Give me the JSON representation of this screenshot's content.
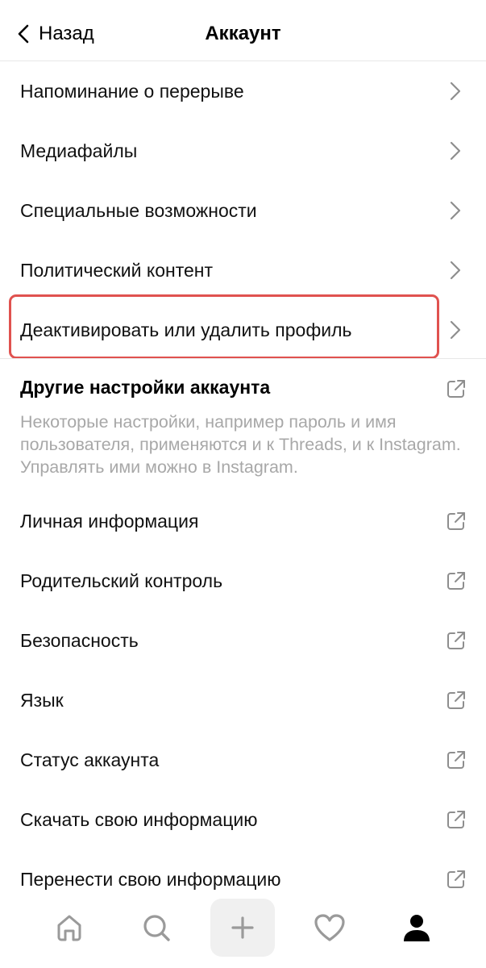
{
  "header": {
    "back_label": "Назад",
    "title": "Аккаунт"
  },
  "items": [
    {
      "label": "Напоминание о перерыве"
    },
    {
      "label": "Медиафайлы"
    },
    {
      "label": "Специальные возможности"
    },
    {
      "label": "Политический контент"
    },
    {
      "label": "Деактивировать или удалить профиль"
    }
  ],
  "section": {
    "title": "Другие настройки аккаунта",
    "description": "Некоторые настройки, например пароль и имя пользователя, применяются и к Threads, и к Instagram. Управлять ими можно в Instagram."
  },
  "external_items": [
    {
      "label": "Личная информация"
    },
    {
      "label": "Родительский контроль"
    },
    {
      "label": "Безопасность"
    },
    {
      "label": "Язык"
    },
    {
      "label": "Статус аккаунта"
    },
    {
      "label": "Скачать свою информацию"
    },
    {
      "label": "Перенести свою информацию"
    }
  ],
  "tabbar": {
    "icons": [
      "home-icon",
      "search-icon",
      "plus-icon",
      "heart-icon",
      "profile-icon"
    ],
    "active": "profile-icon"
  },
  "colors": {
    "highlight": "#e0524f",
    "muted_text": "#a8a8a8",
    "chevron": "#8e8e8e"
  }
}
